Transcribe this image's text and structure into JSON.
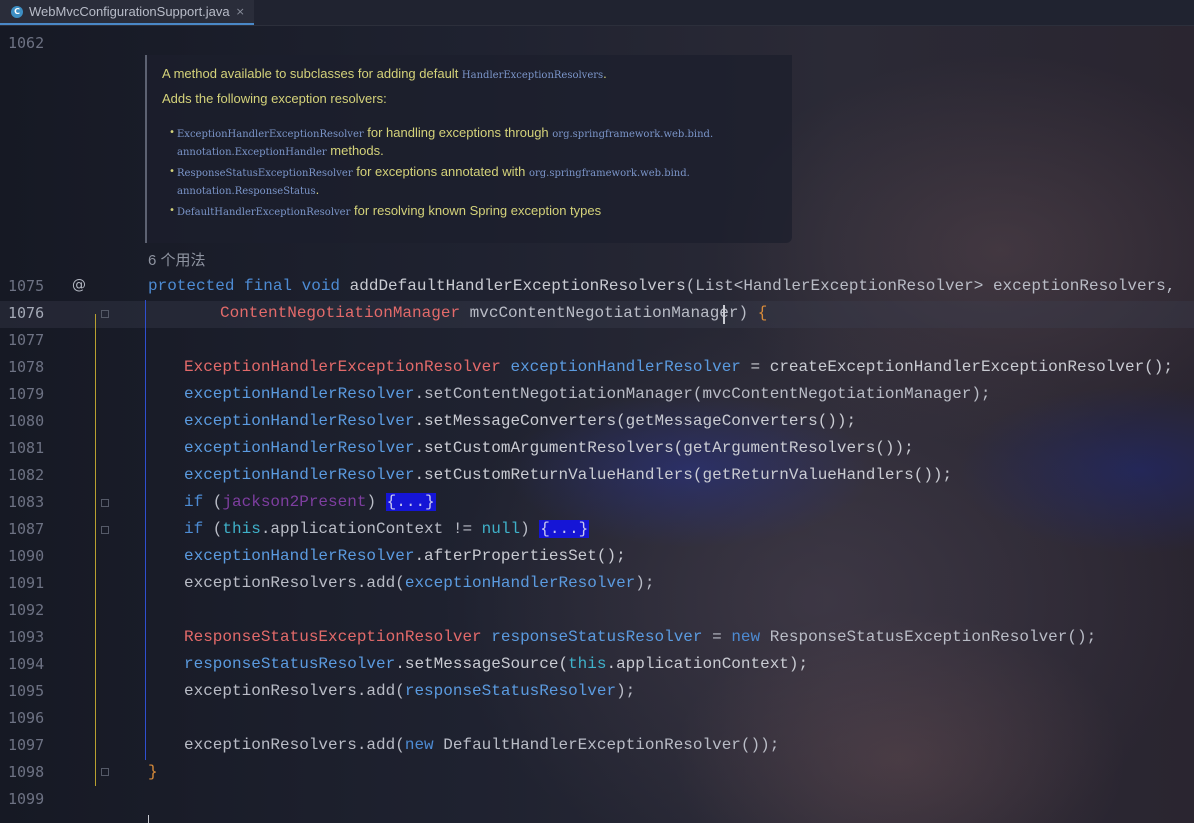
{
  "tab": {
    "icon": "C",
    "filename": "WebMvcConfigurationSupport.java",
    "close": "×"
  },
  "gutter": {
    "first_line": "1062",
    "at_marker": "@",
    "lines": [
      "1075",
      "1076",
      "1077",
      "1078",
      "1079",
      "1080",
      "1081",
      "1082",
      "1083",
      "1087",
      "1090",
      "1091",
      "1092",
      "1093",
      "1094",
      "1095",
      "1096",
      "1097",
      "1098",
      "1099"
    ]
  },
  "doc": {
    "line1_text": "A method available to subclasses for adding default ",
    "line1_code": "HandlerExceptionResolvers",
    "line1_end": ".",
    "line2": "Adds the following exception resolvers:",
    "b1_code": "ExceptionHandlerExceptionResolver",
    "b1_text": " for handling exceptions through ",
    "b1_code2": "org.springframework.web.bind.",
    "b1_code3": "annotation.ExceptionHandler",
    "b1_text2": " methods.",
    "b2_code": "ResponseStatusExceptionResolver",
    "b2_text": " for exceptions annotated with ",
    "b2_code2": "org.springframework.web.bind.",
    "b2_code3": "annotation.ResponseStatus",
    "b2_text2": ".",
    "b3_code": "DefaultHandlerExceptionResolver",
    "b3_text": " for resolving known Spring exception types",
    "bullet": "•"
  },
  "usages": "6 个用法",
  "code": {
    "l1075_a": "protected final void ",
    "l1075_b": "addDefaultHandlerExceptionResolvers",
    "l1075_c": "(List<",
    "l1075_d": "HandlerExceptionResolver",
    "l1075_e": "> exceptionResolvers,",
    "l1076_a": "ContentNegotiationManager",
    "l1076_b": " mvcContentNegotiationManager) ",
    "l1076_c": "{",
    "l1078_a": "ExceptionHandlerExceptionResolver",
    "l1078_b": " exceptionHandlerResolver",
    "l1078_c": " = createExceptionHandlerExceptionResolver();",
    "var_ehr": "exceptionHandlerResolver",
    "l1079": ".setContentNegotiationManager(mvcContentNegotiationManager);",
    "l1080": ".setMessageConverters(getMessageConverters());",
    "l1081": ".setCustomArgumentResolvers(getArgumentResolvers());",
    "l1082": ".setCustomReturnValueHandlers(getReturnValueHandlers());",
    "if_kw": "if",
    "l1083_a": " (",
    "l1083_b": "jackson2Present",
    "l1083_c": ") ",
    "fold": "{...}",
    "l1087_a": " (",
    "this_kw": "this",
    "l1087_b": ".applicationContext != ",
    "null_kw": "null",
    "l1087_c": ") ",
    "l1090": ".afterPropertiesSet();",
    "l1091_a": "exceptionResolvers.add(",
    "l1091_b": "exceptionHandlerResolver",
    "l1091_c": ");",
    "l1093_a": "ResponseStatusExceptionResolver",
    "l1093_b": " responseStatusResolver",
    "l1093_c": " = ",
    "new_kw": "new",
    "l1093_d": " ResponseStatusExceptionResolver();",
    "var_rsr": "responseStatusResolver",
    "l1094_a": ".setMessageSource(",
    "l1094_b": ".applicationContext);",
    "l1095_a": "exceptionResolvers.add(",
    "l1095_b": "responseStatusResolver",
    "l1095_c": ");",
    "l1097_a": "exceptionResolvers.add(",
    "l1097_b": " DefaultHandlerExceptionResolver());",
    "close_brace": "}"
  }
}
